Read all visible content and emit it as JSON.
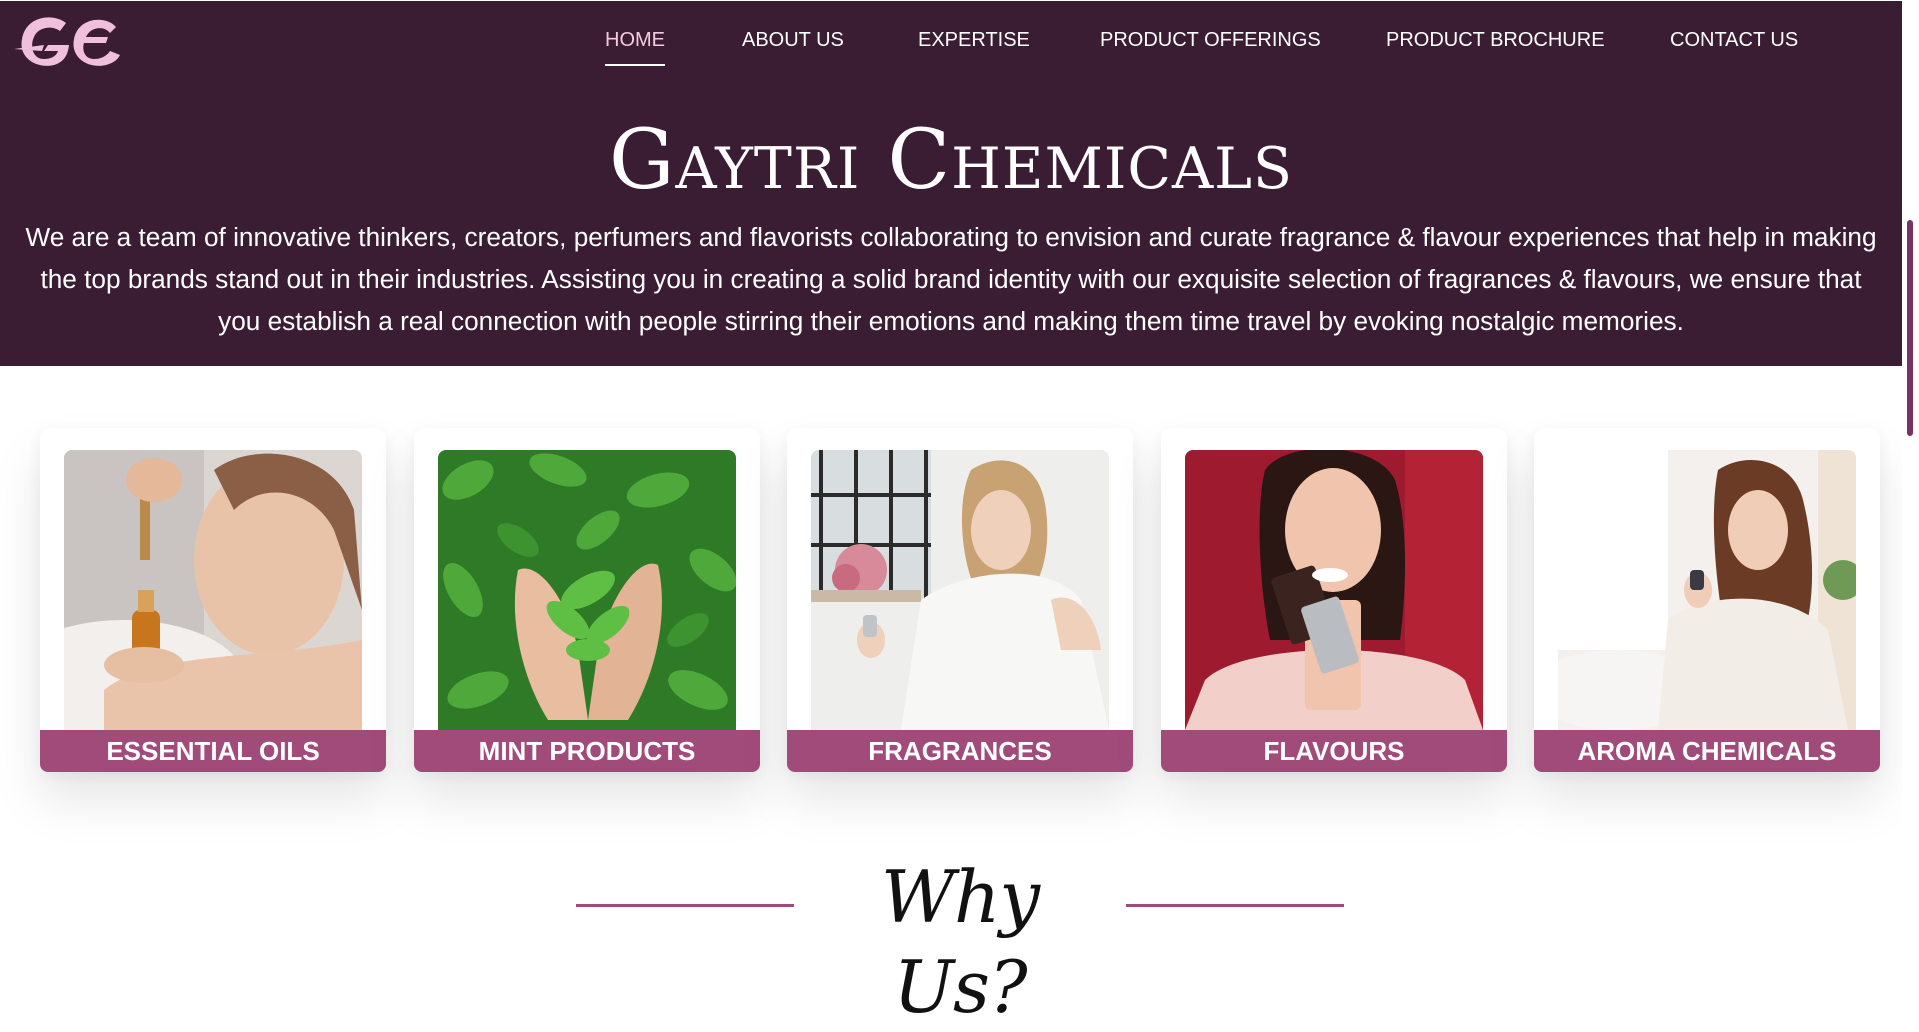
{
  "header": {
    "logo_text": "GC",
    "nav": [
      {
        "label": "HOME",
        "active": true
      },
      {
        "label": "ABOUT US",
        "active": false
      },
      {
        "label": "EXPERTISE",
        "active": false
      },
      {
        "label": "PRODUCT OFFERINGS",
        "active": false
      },
      {
        "label": "PRODUCT BROCHURE",
        "active": false
      },
      {
        "label": "CONTACT US",
        "active": false
      }
    ]
  },
  "hero": {
    "title": "Gaytri Chemicals",
    "intro_lines": [
      "We are a team of innovative thinkers, creators, perfumers and flavorists collaborating to envision and curate fragrance & flavour experiences that help in making",
      "the top brands stand out in their industries. Assisting you in creating a solid brand identity with our exquisite selection of fragrances & flavours, we ensure that",
      "you establish a real connection with people stirring their emotions and making them time travel by evoking nostalgic memories."
    ]
  },
  "categories": [
    {
      "label": "ESSENTIAL OILS",
      "photo": "woman-with-dropper-oil-photo"
    },
    {
      "label": "MINT PRODUCTS",
      "photo": "hands-holding-mint-photo"
    },
    {
      "label": "FRAGRANCES",
      "photo": "woman-spraying-perfume-photo"
    },
    {
      "label": "FLAVOURS",
      "photo": "woman-eating-chocolate-photo"
    },
    {
      "label": "AROMA CHEMICALS",
      "photo": "woman-in-robe-perfume-photo"
    }
  ],
  "why_section": {
    "title": "Why Us?"
  },
  "colors": {
    "hero_background": "#3a1c33",
    "accent": "#a14b7a",
    "logo_pink": "#f0bfdc",
    "active_nav": "#f3cbe0"
  }
}
